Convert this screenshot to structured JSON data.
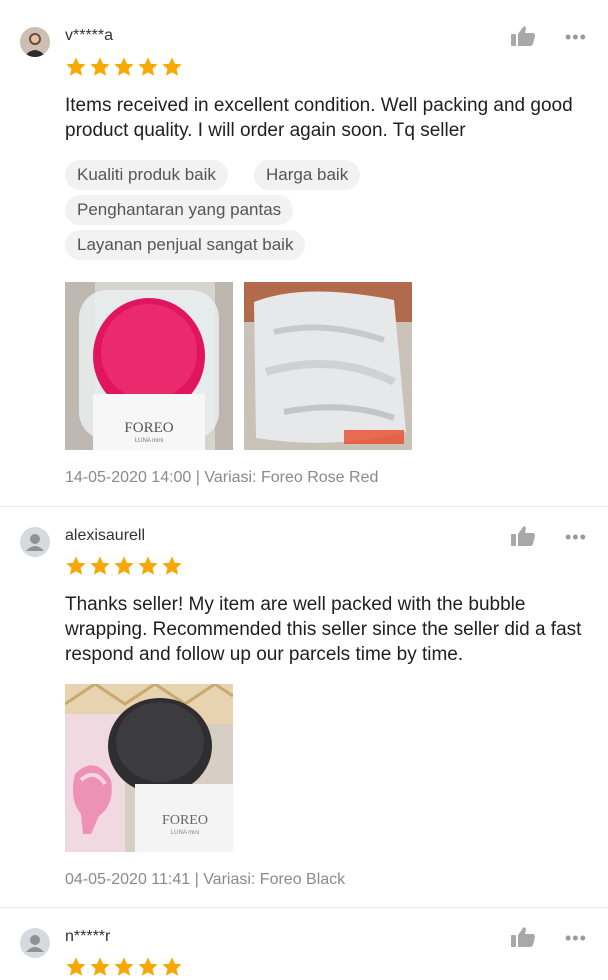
{
  "reviews": [
    {
      "username": "v*****a",
      "rating": 5,
      "comment": "Items received in excellent condition. Well packing and good product quality. I will order again soon. Tq seller",
      "tags": [
        "Kualiti produk baik",
        "Harga baik",
        "Penghantaran yang pantas",
        "Layanan penjual sangat baik"
      ],
      "meta": "14-05-2020 14:00 | Variasi: Foreo Rose Red",
      "images": [
        {
          "brand": "FOREO",
          "model": "LUNA mini"
        },
        {
          "brand": "",
          "model": ""
        }
      ]
    },
    {
      "username": "alexisaurell",
      "rating": 5,
      "comment": "Thanks seller! My item are well packed with the bubble wrapping. Recommended this seller since the seller did a fast respond and follow up our parcels time by time.",
      "meta": "04-05-2020 11:41 | Variasi: Foreo Black",
      "images": [
        {
          "brand": "FOREO",
          "model": "LUNA mini"
        }
      ]
    },
    {
      "username": "n*****r",
      "rating": 5
    }
  ],
  "icons": {
    "like": "thumbs-up-icon",
    "more": "more-dots-icon",
    "star": "star-icon",
    "avatar": "user-avatar-icon"
  },
  "more_label": "•••",
  "colors": {
    "star": "#f6a700",
    "like": "#a8a8a8",
    "tag_bg": "#f2f2f2",
    "meta_text": "#8a8a8a"
  }
}
